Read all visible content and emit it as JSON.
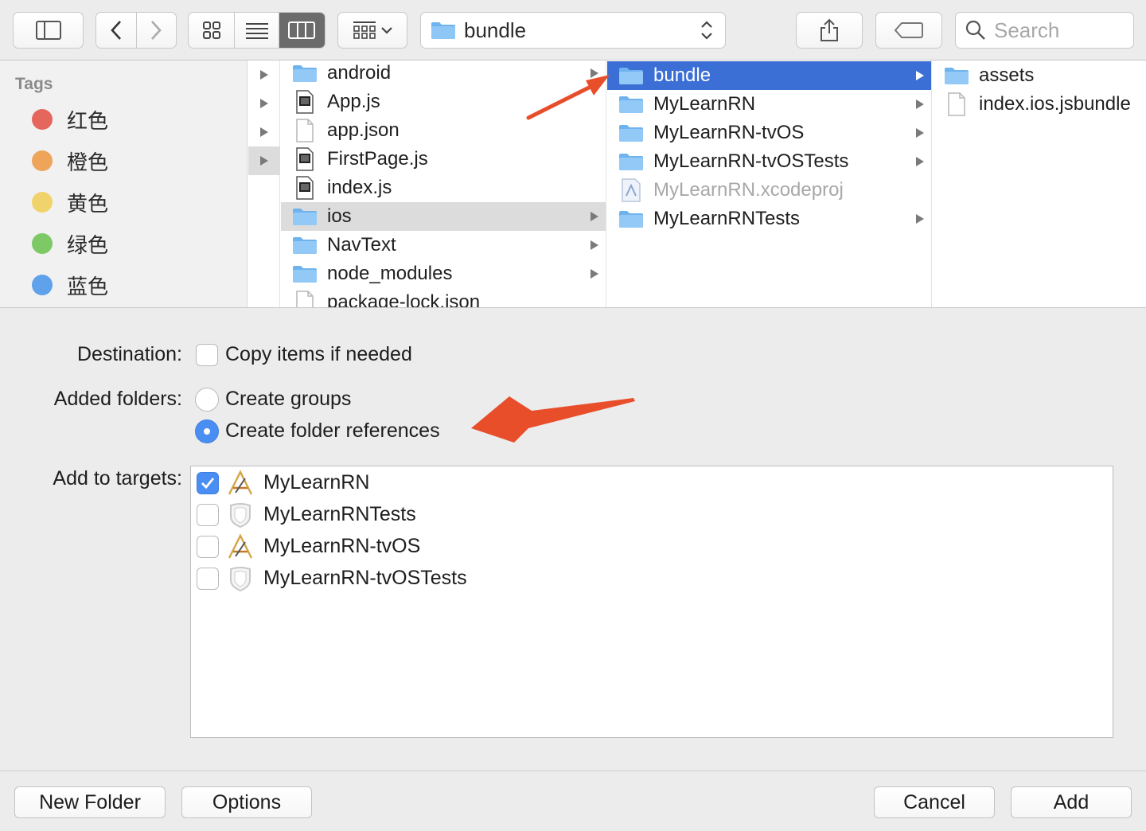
{
  "toolbar": {
    "path_label": "bundle",
    "search_placeholder": "Search"
  },
  "sidebar": {
    "header": "Tags",
    "tags": [
      {
        "name": "红色",
        "color": "#e5665c"
      },
      {
        "name": "橙色",
        "color": "#eea55a"
      },
      {
        "name": "黄色",
        "color": "#f1d36b"
      },
      {
        "name": "绿色",
        "color": "#7dc966"
      },
      {
        "name": "蓝色",
        "color": "#5fa1ea"
      }
    ]
  },
  "columns": {
    "project": [
      {
        "name": "android",
        "kind": "folder",
        "has_children": true
      },
      {
        "name": "App.js",
        "kind": "js",
        "has_children": false
      },
      {
        "name": "app.json",
        "kind": "file",
        "has_children": false
      },
      {
        "name": "FirstPage.js",
        "kind": "js",
        "has_children": false
      },
      {
        "name": "index.js",
        "kind": "js",
        "has_children": false
      },
      {
        "name": "ios",
        "kind": "folder",
        "has_children": true,
        "selected": true
      },
      {
        "name": "NavText",
        "kind": "folder",
        "has_children": true
      },
      {
        "name": "node_modules",
        "kind": "folder",
        "has_children": true
      },
      {
        "name": "package-lock.json",
        "kind": "file",
        "has_children": false
      }
    ],
    "ios": [
      {
        "name": "bundle",
        "kind": "folder",
        "has_children": true,
        "selected": true
      },
      {
        "name": "MyLearnRN",
        "kind": "folder",
        "has_children": true
      },
      {
        "name": "MyLearnRN-tvOS",
        "kind": "folder",
        "has_children": true
      },
      {
        "name": "MyLearnRN-tvOSTests",
        "kind": "folder",
        "has_children": true
      },
      {
        "name": "MyLearnRN.xcodeproj",
        "kind": "xcodeproj",
        "has_children": false,
        "dimmed": true
      },
      {
        "name": "MyLearnRNTests",
        "kind": "folder",
        "has_children": true
      }
    ],
    "bundle": [
      {
        "name": "assets",
        "kind": "folder",
        "has_children": false
      },
      {
        "name": "index.ios.jsbundle",
        "kind": "file",
        "has_children": false
      }
    ]
  },
  "options": {
    "destination_label": "Destination:",
    "copy_items_label": "Copy items if needed",
    "copy_items_checked": false,
    "added_folders_label": "Added folders:",
    "create_groups_label": "Create groups",
    "create_folder_refs_label": "Create folder references",
    "selected_folder_option": "Create folder references",
    "add_to_targets_label": "Add to targets:",
    "targets": [
      {
        "name": "MyLearnRN",
        "checked": true,
        "icon": "app-target-icon"
      },
      {
        "name": "MyLearnRNTests",
        "checked": false,
        "icon": "test-target-icon"
      },
      {
        "name": "MyLearnRN-tvOS",
        "checked": false,
        "icon": "app-target-icon"
      },
      {
        "name": "MyLearnRN-tvOSTests",
        "checked": false,
        "icon": "test-target-icon"
      }
    ]
  },
  "footer": {
    "new_folder": "New Folder",
    "options": "Options",
    "cancel": "Cancel",
    "add": "Add"
  },
  "colors": {
    "selection_blue": "#3b6fd6",
    "accent": "#4a8ef3",
    "annotation_arrow": "#e94e2a"
  }
}
